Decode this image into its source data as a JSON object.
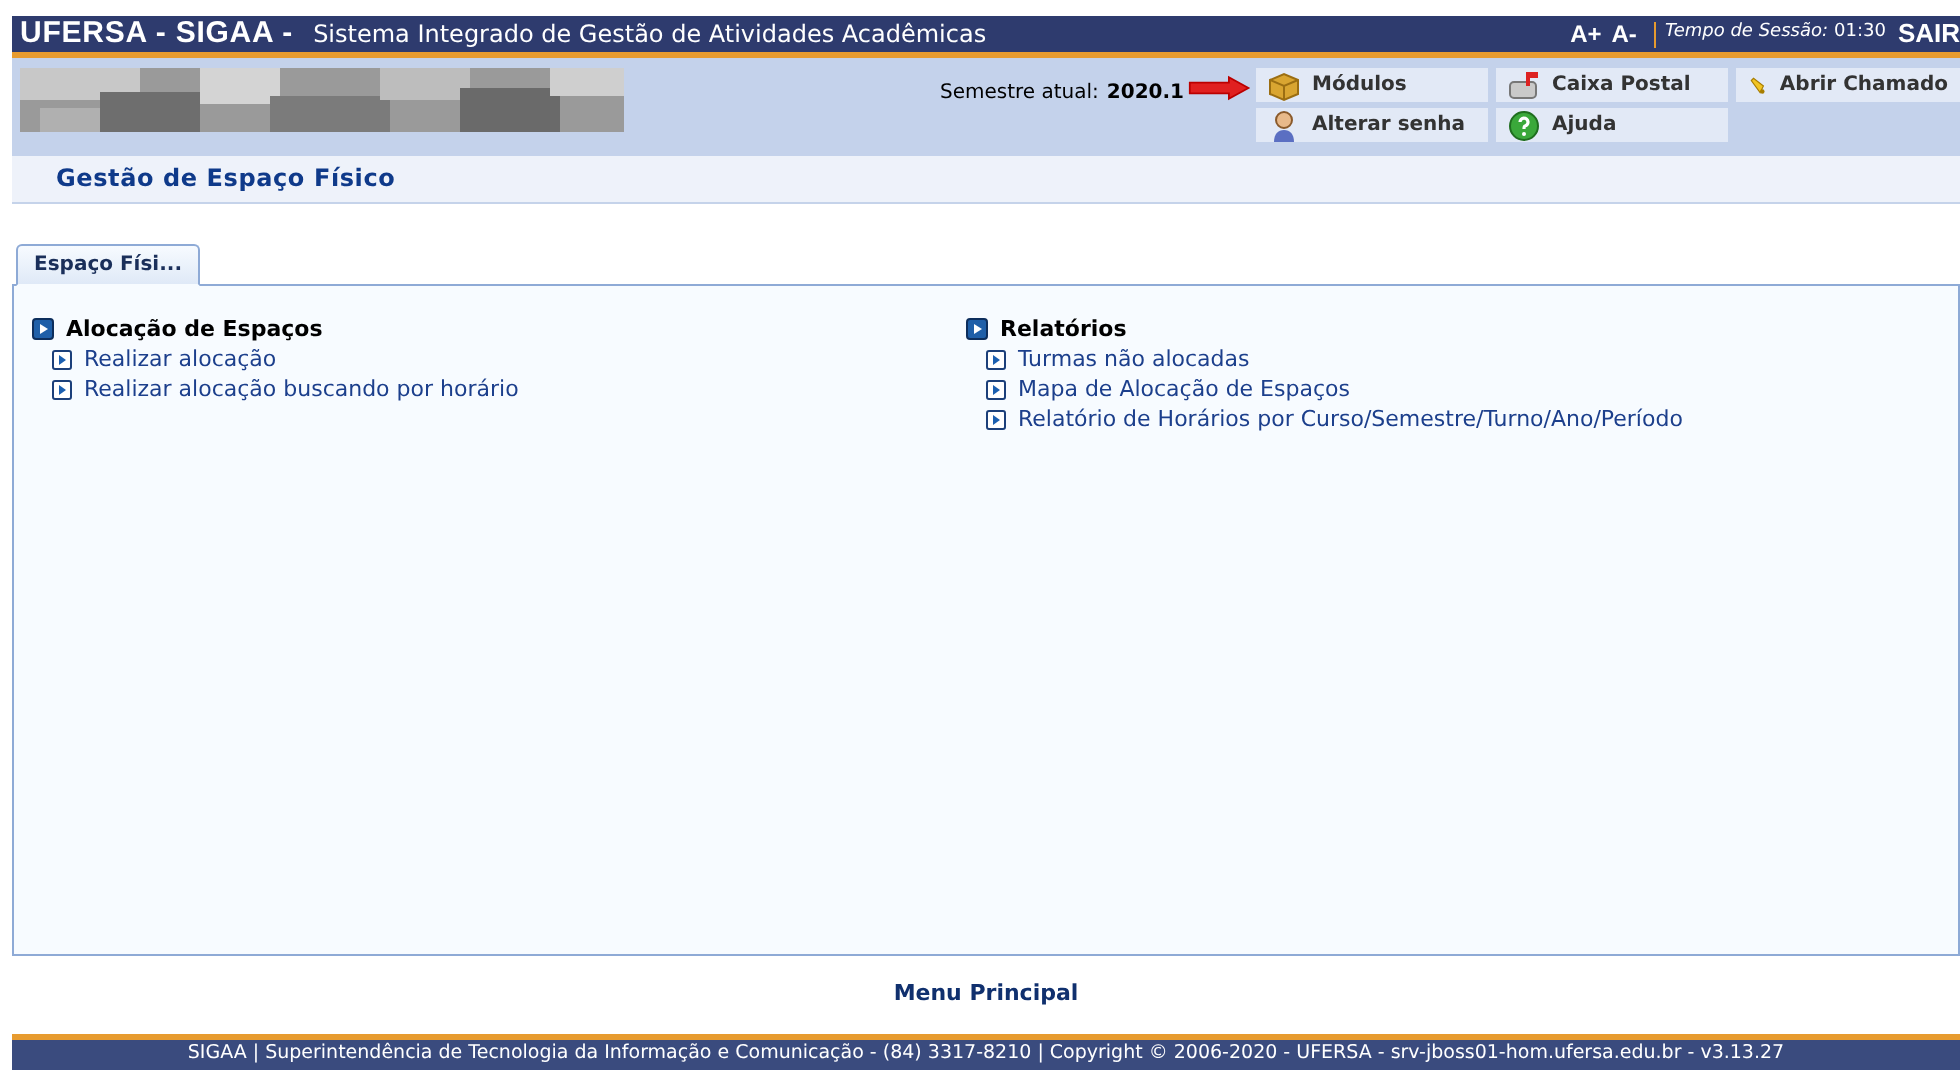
{
  "top_bar": {
    "system": "UFERSA - SIGAA -",
    "title": "Sistema Integrado de Gestão de Atividades Acadêmicas",
    "font_buttons": [
      "A+",
      "A-"
    ],
    "session_label": "Tempo de Sessão:",
    "session_time": "01:30",
    "logout": "SAIR"
  },
  "header": {
    "semester_label": "Semestre atual:",
    "semester": "2020.1",
    "buttons": [
      {
        "label": "Módulos",
        "kind": "modules",
        "pointed": true
      },
      {
        "label": "Caixa Postal",
        "kind": "mail",
        "pointed": false
      },
      {
        "label": "Abrir Chamado",
        "kind": "bell",
        "pointed": false
      },
      {
        "label": "Alterar senha",
        "kind": "user",
        "pointed": false
      },
      {
        "label": "Ajuda",
        "kind": "help",
        "pointed": false
      }
    ]
  },
  "page_title": "Gestão de Espaço Físico",
  "tabs": [
    {
      "label": "Espaço Físi...",
      "selected": true
    }
  ],
  "sections": [
    {
      "title": "Alocação de Espaços",
      "items": [
        "Realizar alocação",
        "Realizar alocação buscando por horário"
      ]
    },
    {
      "title": "Relatórios",
      "items": [
        "Turmas não alocadas",
        "Mapa de Alocação de Espaços",
        "Relatório de Horários por Curso/Semestre/Turno/Ano/Período"
      ]
    }
  ],
  "menu_link": "Menu Principal",
  "footer": "SIGAA | Superintendência de Tecnologia da Informação e Comunicação - (84) 3317-8210 | Copyright © 2006-2020 - UFERSA - srv-jboss01-hom.ufersa.edu.br - v3.13.27"
}
